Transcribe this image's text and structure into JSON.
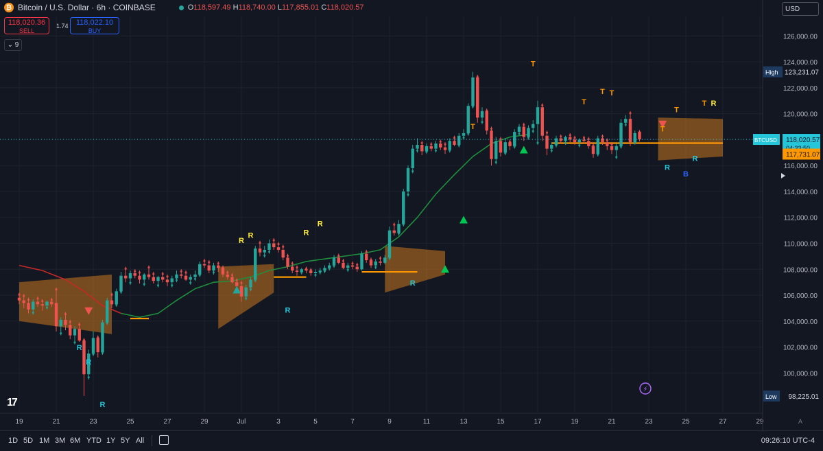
{
  "header": {
    "symbol_title": "Bitcoin / U.S. Dollar · 6h · COINBASE",
    "ohlc": {
      "o_label": "O",
      "o": "118,597.49",
      "h_label": "H",
      "h": "118,740.00",
      "l_label": "L",
      "l": "117,855.01",
      "c_label": "C",
      "c": "118,020.57"
    }
  },
  "trade": {
    "sell_price": "118,020.36",
    "sell_label": "SELL",
    "spread": "1.74",
    "buy_price": "118,022.10",
    "buy_label": "BUY"
  },
  "indicator_count": "9",
  "currency": "USD",
  "bottom": {
    "ranges": [
      "1D",
      "5D",
      "1M",
      "3M",
      "6M",
      "YTD",
      "1Y",
      "5Y",
      "All"
    ],
    "clock": "09:26:10 UTC-4"
  },
  "colors": {
    "bg": "#131722",
    "up": "#26a69a",
    "down": "#ef5350",
    "band": "#c8761e",
    "trend_up": "#1f8e3d",
    "trend_down": "#c62828",
    "level": "#ff9800"
  },
  "chart_data": {
    "type": "candlestick",
    "ylim": [
      97000,
      127500
    ],
    "y_ticks": [
      100000,
      102000,
      104000,
      106000,
      108000,
      110000,
      112000,
      114000,
      116000,
      118000,
      120000,
      122000,
      124000,
      126000
    ],
    "y_tick_labels": [
      "100,000.00",
      "102,000.00",
      "104,000.00",
      "106,000.00",
      "108,000.00",
      "110,000.00",
      "112,000.00",
      "114,000.00",
      "116,000.00",
      "118,000.00",
      "120,000.00",
      "122,000.00",
      "124,000.00",
      "126,000.00"
    ],
    "x_tick_labels": [
      "19",
      "21",
      "23",
      "25",
      "27",
      "29",
      "Jul",
      "3",
      "5",
      "7",
      "9",
      "11",
      "13",
      "15",
      "17",
      "19",
      "21",
      "23",
      "25",
      "27",
      "29"
    ],
    "x_tick_index": [
      0,
      8,
      16,
      24,
      32,
      40,
      48,
      56,
      64,
      72,
      80,
      88,
      96,
      104,
      112,
      120,
      128,
      136,
      144,
      152,
      160
    ],
    "markers": {
      "high": {
        "label": "High",
        "value": 123231.07,
        "text": "123,231.07"
      },
      "low": {
        "label": "Low",
        "value": 98225.01,
        "text": "98,225.01"
      },
      "last": {
        "label": "BTCUSD",
        "value": 118020.57,
        "text": "118,020.57",
        "countdown": "04:33:50"
      },
      "level": {
        "value": 117731.07,
        "text": "117,731.07"
      }
    },
    "candles": [
      [
        105800,
        106200,
        105300,
        105600
      ],
      [
        105600,
        106100,
        105000,
        105400
      ],
      [
        105400,
        105800,
        104600,
        104900
      ],
      [
        104900,
        105700,
        104500,
        105500
      ],
      [
        105500,
        105900,
        105100,
        105300
      ],
      [
        105300,
        105700,
        104800,
        105200
      ],
      [
        105200,
        105600,
        104900,
        105500
      ],
      [
        105500,
        105800,
        105100,
        105300
      ],
      [
        105400,
        106600,
        103200,
        103600
      ],
      [
        103600,
        104300,
        102900,
        104100
      ],
      [
        104100,
        104700,
        103300,
        103700
      ],
      [
        103700,
        104100,
        102600,
        102900
      ],
      [
        102900,
        103600,
        102200,
        103400
      ],
      [
        103400,
        103900,
        102400,
        102500
      ],
      [
        102500,
        102700,
        98225,
        99900
      ],
      [
        99900,
        101800,
        99500,
        101500
      ],
      [
        101500,
        103200,
        101300,
        102700
      ],
      [
        102700,
        102900,
        101200,
        101600
      ],
      [
        101600,
        104100,
        101400,
        103900
      ],
      [
        103900,
        105800,
        103700,
        105600
      ],
      [
        105600,
        106200,
        105000,
        105300
      ],
      [
        105300,
        106500,
        105100,
        106300
      ],
      [
        106300,
        107800,
        106100,
        107500
      ],
      [
        107500,
        108200,
        107000,
        107300
      ],
      [
        107300,
        107900,
        106800,
        107700
      ],
      [
        107700,
        108000,
        107300,
        107500
      ],
      [
        107500,
        107900,
        106900,
        107200
      ],
      [
        107200,
        107700,
        106700,
        107600
      ],
      [
        107600,
        108300,
        107200,
        107400
      ],
      [
        107400,
        107800,
        106900,
        107100
      ],
      [
        107100,
        107500,
        106600,
        107400
      ],
      [
        107400,
        107800,
        107000,
        107200
      ],
      [
        107200,
        107600,
        106700,
        107000
      ],
      [
        107000,
        107500,
        106600,
        107300
      ],
      [
        107300,
        107900,
        107000,
        107600
      ],
      [
        107600,
        108000,
        107300,
        107500
      ],
      [
        107500,
        107900,
        107100,
        107200
      ],
      [
        107200,
        107600,
        106800,
        107400
      ],
      [
        107400,
        107900,
        107100,
        107600
      ],
      [
        107600,
        108600,
        107400,
        108400
      ],
      [
        108400,
        108800,
        108100,
        108300
      ],
      [
        108300,
        108700,
        107700,
        107900
      ],
      [
        107900,
        108500,
        107600,
        108300
      ],
      [
        108300,
        108600,
        107800,
        108100
      ],
      [
        108100,
        108300,
        107400,
        107600
      ],
      [
        107600,
        107900,
        107200,
        107400
      ],
      [
        107400,
        107700,
        106900,
        107000
      ],
      [
        107000,
        107300,
        106400,
        106700
      ],
      [
        106700,
        107100,
        105500,
        105900
      ],
      [
        105900,
        106800,
        105600,
        106600
      ],
      [
        106600,
        107400,
        106300,
        107200
      ],
      [
        107200,
        109800,
        107000,
        109600
      ],
      [
        109600,
        110200,
        109000,
        109300
      ],
      [
        109300,
        109800,
        108900,
        109500
      ],
      [
        109500,
        110300,
        109200,
        110000
      ],
      [
        110000,
        110400,
        109500,
        109700
      ],
      [
        109700,
        110100,
        109300,
        109500
      ],
      [
        109500,
        109900,
        108700,
        108900
      ],
      [
        108900,
        109200,
        108000,
        108200
      ],
      [
        108200,
        108600,
        107700,
        107900
      ],
      [
        107900,
        108300,
        107500,
        107800
      ],
      [
        107800,
        108100,
        107600,
        108000
      ],
      [
        108000,
        108200,
        107700,
        107900
      ],
      [
        107900,
        108100,
        107500,
        107700
      ],
      [
        107700,
        108000,
        107400,
        107800
      ],
      [
        107800,
        108100,
        107600,
        107900
      ],
      [
        107900,
        108300,
        107700,
        108100
      ],
      [
        108100,
        108500,
        107900,
        108300
      ],
      [
        108300,
        109100,
        108100,
        108900
      ],
      [
        108900,
        109200,
        108400,
        108500
      ],
      [
        108500,
        108800,
        108000,
        108100
      ],
      [
        108100,
        108500,
        107800,
        108300
      ],
      [
        108300,
        108600,
        108000,
        108200
      ],
      [
        108200,
        108500,
        107800,
        108000
      ],
      [
        108000,
        109400,
        107900,
        109200
      ],
      [
        109200,
        109500,
        108500,
        108700
      ],
      [
        108700,
        108900,
        108100,
        108300
      ],
      [
        108300,
        108800,
        108000,
        108600
      ],
      [
        108600,
        109000,
        108300,
        108500
      ],
      [
        108500,
        109100,
        108400,
        108900
      ],
      [
        108900,
        111300,
        108700,
        111000
      ],
      [
        111000,
        111600,
        110600,
        110800
      ],
      [
        110800,
        111800,
        110600,
        111500
      ],
      [
        111500,
        114200,
        111300,
        114000
      ],
      [
        114000,
        116000,
        113600,
        115800
      ],
      [
        115800,
        117600,
        115400,
        117300
      ],
      [
        117300,
        118100,
        117000,
        117600
      ],
      [
        117600,
        117900,
        116800,
        117100
      ],
      [
        117100,
        117700,
        116900,
        117500
      ],
      [
        117500,
        117800,
        117100,
        117300
      ],
      [
        117300,
        117900,
        117000,
        117700
      ],
      [
        117700,
        118000,
        117200,
        117400
      ],
      [
        117400,
        117800,
        116900,
        117200
      ],
      [
        117200,
        118100,
        117000,
        117900
      ],
      [
        117900,
        118300,
        117500,
        117600
      ],
      [
        117600,
        118500,
        117400,
        118300
      ],
      [
        118300,
        118800,
        118000,
        118500
      ],
      [
        118500,
        120800,
        118300,
        120600
      ],
      [
        120600,
        123231,
        120400,
        122800
      ],
      [
        122800,
        123000,
        119300,
        119700
      ],
      [
        119700,
        120500,
        119200,
        120200
      ],
      [
        120200,
        120400,
        118400,
        118700
      ],
      [
        118700,
        119000,
        116000,
        116500
      ],
      [
        116500,
        118200,
        116100,
        117900
      ],
      [
        117900,
        118200,
        116700,
        117000
      ],
      [
        117000,
        118100,
        116800,
        117800
      ],
      [
        117800,
        118000,
        117200,
        117500
      ],
      [
        117500,
        118800,
        117300,
        118600
      ],
      [
        118600,
        119200,
        118300,
        119000
      ],
      [
        119000,
        119300,
        117900,
        118200
      ],
      [
        118200,
        119100,
        118000,
        118900
      ],
      [
        118900,
        119500,
        118500,
        119200
      ],
      [
        119200,
        121000,
        117600,
        120500
      ],
      [
        120500,
        120800,
        117900,
        118300
      ],
      [
        118300,
        118700,
        116800,
        117300
      ],
      [
        117300,
        117800,
        117000,
        117600
      ],
      [
        117600,
        118300,
        117400,
        118100
      ],
      [
        118100,
        118400,
        117700,
        117900
      ],
      [
        117900,
        118300,
        117600,
        118200
      ],
      [
        118200,
        118500,
        117800,
        118000
      ],
      [
        118000,
        118300,
        117600,
        117800
      ],
      [
        117800,
        118100,
        117400,
        118000
      ],
      [
        118000,
        118300,
        117700,
        117900
      ],
      [
        117900,
        118200,
        117300,
        117500
      ],
      [
        117500,
        117700,
        116600,
        116900
      ],
      [
        116900,
        118300,
        116700,
        118100
      ],
      [
        118100,
        118400,
        117600,
        117800
      ],
      [
        117800,
        118100,
        117200,
        117500
      ],
      [
        117500,
        117800,
        116900,
        117200
      ],
      [
        117200,
        117700,
        116500,
        117500
      ],
      [
        117500,
        119600,
        117300,
        119300
      ],
      [
        119300,
        119900,
        119000,
        119600
      ],
      [
        119600,
        120200,
        117500,
        117800
      ],
      [
        117800,
        118700,
        117600,
        118500
      ],
      [
        118597,
        118740,
        117855,
        118020
      ]
    ],
    "trend_line": [
      [
        0,
        108300
      ],
      [
        5,
        107900
      ],
      [
        10,
        107200
      ],
      [
        14,
        106300
      ],
      [
        18,
        105200
      ],
      [
        22,
        104600
      ],
      [
        26,
        104300
      ],
      [
        30,
        104600
      ],
      [
        34,
        105600
      ],
      [
        38,
        106500
      ],
      [
        42,
        107000
      ],
      [
        46,
        107100
      ],
      [
        50,
        107400
      ],
      [
        54,
        107900
      ],
      [
        58,
        108200
      ],
      [
        62,
        108600
      ],
      [
        66,
        108800
      ],
      [
        70,
        109000
      ],
      [
        74,
        109200
      ],
      [
        78,
        109500
      ],
      [
        82,
        110500
      ],
      [
        86,
        112000
      ],
      [
        90,
        113800
      ],
      [
        94,
        115300
      ],
      [
        98,
        116700
      ],
      [
        102,
        117700
      ],
      [
        106,
        118200
      ],
      [
        110,
        118400
      ]
    ],
    "trend_red_until": 22,
    "level_segments": [
      {
        "from": 24,
        "to": 28,
        "value": 104200
      },
      {
        "from": 55,
        "to": 62,
        "value": 107400
      },
      {
        "from": 74,
        "to": 86,
        "value": 107800
      },
      {
        "from": 115,
        "to": 152,
        "value": 117731
      }
    ],
    "bands": [
      {
        "from": 0,
        "to": 20,
        "top": [
          107000,
          107600
        ],
        "bottom": [
          104000,
          103000
        ]
      },
      {
        "from": 43,
        "to": 55,
        "top": [
          108200,
          108400
        ],
        "bottom": [
          103400,
          106200
        ]
      },
      {
        "from": 79,
        "to": 92,
        "top": [
          109800,
          109400
        ],
        "bottom": [
          106200,
          107600
        ]
      },
      {
        "from": 138,
        "to": 152,
        "top": [
          119700,
          119600
        ],
        "bottom": [
          116400,
          116700
        ]
      }
    ],
    "signals": [
      {
        "i": 13,
        "text": "R",
        "value": 102600,
        "color": "#26c6da",
        "pos": "below"
      },
      {
        "i": 15,
        "text": "R",
        "value": 101500,
        "color": "#26c6da",
        "pos": "below"
      },
      {
        "i": 18,
        "text": "R",
        "value": 98225,
        "color": "#26c6da",
        "pos": "below"
      },
      {
        "i": 48,
        "text": "R",
        "value": 109600,
        "color": "#ffeb3b",
        "pos": "above"
      },
      {
        "i": 50,
        "text": "R",
        "value": 110000,
        "color": "#ffeb3b",
        "pos": "above"
      },
      {
        "i": 58,
        "text": "R",
        "value": 105500,
        "color": "#26c6da",
        "pos": "below"
      },
      {
        "i": 62,
        "text": "R",
        "value": 110200,
        "color": "#ffeb3b",
        "pos": "above"
      },
      {
        "i": 65,
        "text": "R",
        "value": 110900,
        "color": "#ffeb3b",
        "pos": "above"
      },
      {
        "i": 85,
        "text": "R",
        "value": 107600,
        "color": "#26c6da",
        "pos": "below"
      },
      {
        "i": 98,
        "text": "T",
        "value": 118400,
        "color": "#ff9800",
        "pos": "above"
      },
      {
        "i": 111,
        "text": "T",
        "value": 123231,
        "color": "#ff9800",
        "pos": "above"
      },
      {
        "i": 122,
        "text": "T",
        "value": 120300,
        "color": "#ff9800",
        "pos": "above"
      },
      {
        "i": 126,
        "text": "T",
        "value": 121100,
        "color": "#ff9800",
        "pos": "above"
      },
      {
        "i": 128,
        "text": "T",
        "value": 121000,
        "color": "#ff9800",
        "pos": "above"
      },
      {
        "i": 139,
        "text": "T",
        "value": 118200,
        "color": "#ff9800",
        "pos": "above"
      },
      {
        "i": 142,
        "text": "T",
        "value": 119700,
        "color": "#ff9800",
        "pos": "above"
      },
      {
        "i": 140,
        "text": "R",
        "value": 116500,
        "color": "#26c6da",
        "pos": "below"
      },
      {
        "i": 144,
        "text": "B",
        "value": 116000,
        "color": "#2962ff",
        "pos": "below"
      },
      {
        "i": 146,
        "text": "R",
        "value": 117200,
        "color": "#26c6da",
        "pos": "below"
      },
      {
        "i": 148,
        "text": "T",
        "value": 120200,
        "color": "#ff9800",
        "pos": "above"
      },
      {
        "i": 150,
        "text": "R",
        "value": 120200,
        "color": "#ffeb3b",
        "pos": "above"
      }
    ],
    "triangles": [
      {
        "i": 15,
        "value": 104800,
        "dir": "down",
        "color": "#ef5350"
      },
      {
        "i": 47,
        "value": 106400,
        "dir": "up",
        "color": "#26a69a"
      },
      {
        "i": 92,
        "value": 108000,
        "dir": "up",
        "color": "#00c853"
      },
      {
        "i": 96,
        "value": 111800,
        "dir": "up",
        "color": "#00c853"
      },
      {
        "i": 109,
        "value": 117200,
        "dir": "up",
        "color": "#00c853"
      },
      {
        "i": 139,
        "value": 119200,
        "dir": "down",
        "color": "#ef5350"
      }
    ]
  }
}
